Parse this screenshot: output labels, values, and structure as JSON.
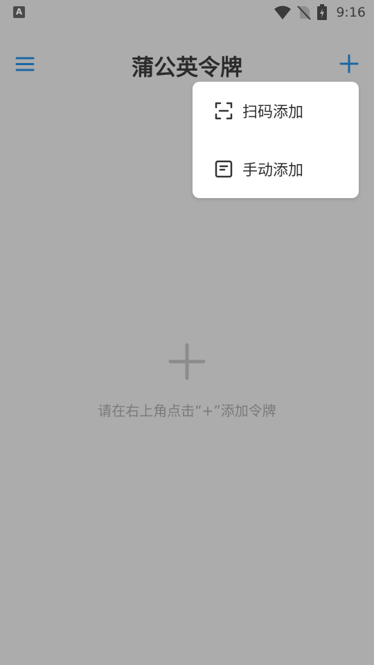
{
  "status_bar": {
    "notification_glyph": "A",
    "time": "9:16",
    "icons": [
      "wifi-icon",
      "no-sim-icon",
      "battery-charging-icon"
    ]
  },
  "app_bar": {
    "title": "蒲公英令牌",
    "left_icon": "menu-icon",
    "right_icon": "plus-icon",
    "accent_color": "#1a66a6"
  },
  "empty_state": {
    "icon": "plus-icon",
    "message": "请在右上角点击“+”添加令牌"
  },
  "add_menu": {
    "items": [
      {
        "label": "扫码添加",
        "icon": "scan-icon"
      },
      {
        "label": "手动添加",
        "icon": "form-icon"
      }
    ]
  }
}
